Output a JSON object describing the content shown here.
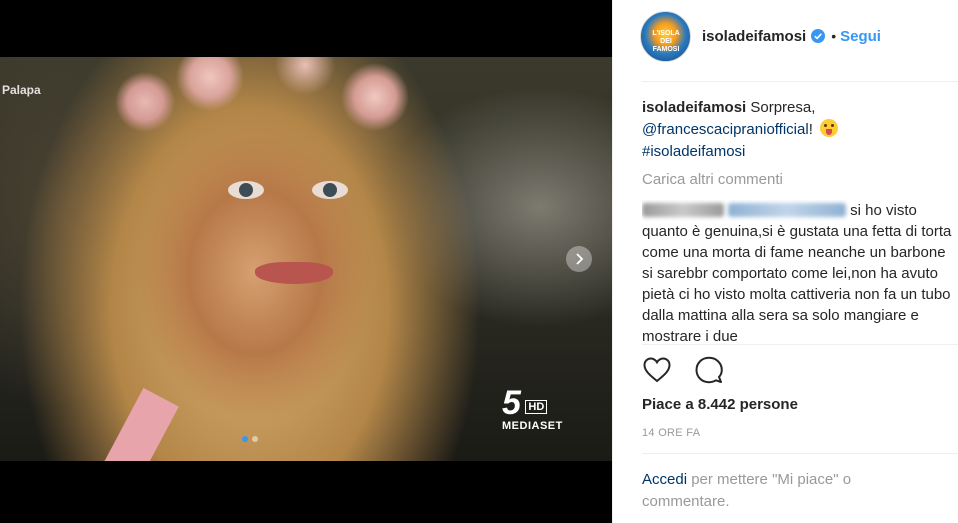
{
  "media": {
    "watermark_left": "Palapa",
    "channel_number": "5",
    "channel_hd": "HD",
    "channel_brand": "MEDIASET",
    "slide_count": 2,
    "active_slide": 1,
    "next_icon": "chevron-right-icon"
  },
  "header": {
    "username": "isoladeifamosi",
    "avatar_text": "L'ISOLA DEI FAMOSI",
    "separator": "•",
    "follow_label": "Segui",
    "verified_icon": "verified-badge-icon"
  },
  "caption": {
    "username": "isoladeifamosi",
    "text_before": "Sorpresa,",
    "mention": "@francescacipraniofficial",
    "text_after": "!",
    "emoji": "winking-tongue-emoji",
    "hashtag": "#isoladeifamosi"
  },
  "comments": {
    "load_more_label": "Carica altri commenti",
    "first": {
      "text": "si ho visto quanto è genuina,si è gustata una fetta di torta come una morta di fame neanche un barbone si sarebbr comportato come lei,non ha avuto pietà ci ho visto molta cattiveria non fa un tubo dalla mattina alla sera sa solo mangiare e mostrare i due"
    }
  },
  "actions": {
    "like_icon": "heart-icon",
    "comment_icon": "comment-bubble-icon"
  },
  "likes": {
    "text": "Piace a 8.442 persone"
  },
  "timestamp": "14 ORE FA",
  "login_prompt": {
    "link": "Accedi",
    "text": " per mettere \"Mi piace\" o commentare."
  },
  "colors": {
    "accent": "#3897f0",
    "link": "#003569",
    "muted": "#999999",
    "text": "#262626"
  }
}
